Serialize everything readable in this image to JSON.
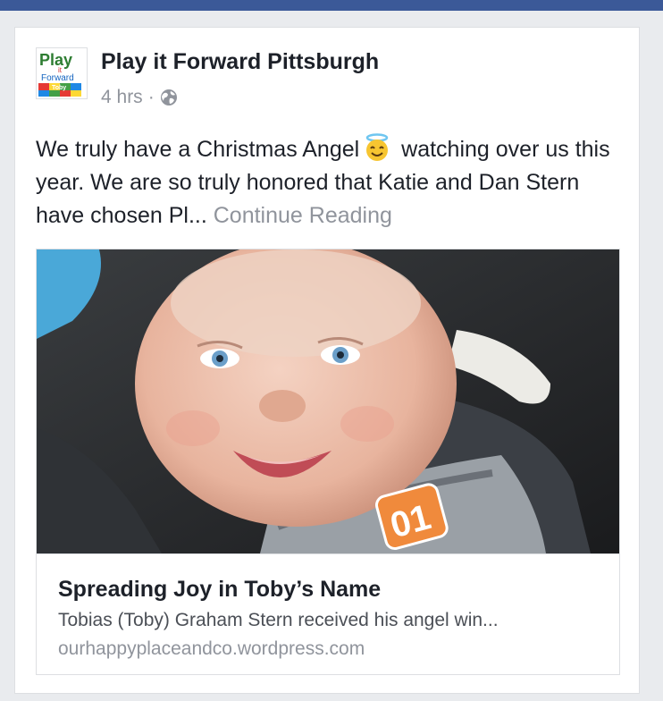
{
  "post": {
    "page_name": "Play it Forward Pittsburgh",
    "timestamp": "4 hrs",
    "separator": "·",
    "privacy_icon": "globe-icon",
    "logo": {
      "line1": "Play",
      "line2": "it",
      "line3": "Forward",
      "blocks": "Toby"
    },
    "text_before_emoji": "We truly have a Christmas Angel",
    "emoji": "smiling-face-with-halo",
    "text_after_emoji": " watching over us this year. We are so truly honored that Katie and Dan Stern have chosen Pl...",
    "continue_label": "Continue Reading"
  },
  "link_preview": {
    "image": "photo-smiling-baby-in-car-seat",
    "shirt_text": "01",
    "title": "Spreading Joy in Toby’s Name",
    "description": "Tobias (Toby) Graham Stern received his angel win...",
    "domain": "ourhappyplaceandco.wordpress.com"
  },
  "colors": {
    "header_bar": "#3b5998",
    "text_primary": "#1d2129",
    "text_secondary": "#90949c",
    "border": "#dddfe2"
  }
}
